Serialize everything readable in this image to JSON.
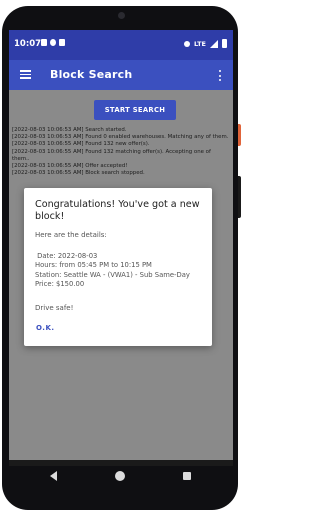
{
  "status_bar": {
    "time": "10:07",
    "network": "LTE",
    "icons_left": [
      "gmail-icon",
      "cloud-icon",
      "sd-card-icon"
    ],
    "icons_right": [
      "mute-icon",
      "wifi-icon",
      "lte-icon",
      "signal-icon",
      "battery-icon"
    ]
  },
  "app_bar": {
    "title": "Block Search"
  },
  "main": {
    "start_button_label": "START SEARCH",
    "log_lines": [
      "[2022-08-03 10:06:53 AM] Search started.",
      "[2022-08-03 10:06:53 AM] Found 0 enabled warehouses. Matching any of them.",
      "[2022-08-03 10:06:55 AM] Found 132 new offer(s).",
      "[2022-08-03 10:06:55 AM] Found 132 matching offer(s). Accepting one of them..",
      "[2022-08-03 10:06:55 AM] Offer accepted!",
      "[2022-08-03 10:06:55 AM] Block search stopped."
    ]
  },
  "dialog": {
    "title": "Congratulations! You've got a new block!",
    "intro": "Here are the details:",
    "details": [
      " Date: 2022-08-03",
      "Hours: from 05:45 PM to 10:15 PM",
      "Station: Seattle WA - (VWA1) - Sub Same-Day",
      "Price: $150.00"
    ],
    "closing": "Drive safe!",
    "ok_label": "O.K."
  },
  "colors": {
    "status_bar": "#2f3da8",
    "app_bar": "#3b50bf",
    "accent": "#3b50bf",
    "background": "#8a8a8a",
    "dialog": "#ffffff"
  }
}
